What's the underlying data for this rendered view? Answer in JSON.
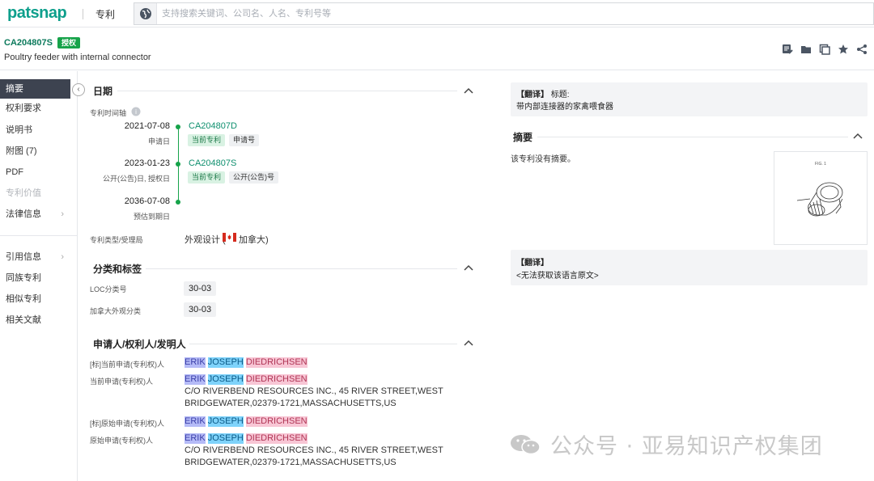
{
  "topbar": {
    "logo": "patsnap",
    "nav_label": "专利",
    "search_placeholder": "支持搜索关键词、公司名、人名、专利号等"
  },
  "header": {
    "patent_id": "CA204807S",
    "status_badge": "授权",
    "title": "Poultry feeder with internal connector"
  },
  "sidebar": {
    "items": [
      {
        "label": "摘要",
        "active": true
      },
      {
        "label": "权利要求"
      },
      {
        "label": "说明书"
      },
      {
        "label": "附图 (7)"
      },
      {
        "label": "PDF"
      },
      {
        "label": "专利价值",
        "disabled": true
      },
      {
        "label": "法律信息",
        "chevron": true
      },
      {
        "label": "引用信息",
        "chevron": true
      },
      {
        "label": "同族专利"
      },
      {
        "label": "相似专利"
      },
      {
        "label": "相关文献"
      }
    ]
  },
  "dates": {
    "section_title": "日期",
    "timeline_label": "专利时间轴",
    "events": [
      {
        "date": "2021-07-08",
        "sub": "申请日",
        "link": "CA204807D",
        "chips": [
          "当前专利",
          "申请号"
        ]
      },
      {
        "date": "2023-01-23",
        "sub": "公开(公告)日, 授权日",
        "link": "CA204807S",
        "chips": [
          "当前专利",
          "公开(公告)号"
        ]
      },
      {
        "date": "2036-07-08",
        "sub": "预估到期日"
      }
    ],
    "type_label": "专利类型/受理局",
    "type_value_prefix": "外观设计 (",
    "type_value_country": "加拿大)"
  },
  "classification": {
    "section_title": "分类和标签",
    "loc_label": "LOC分类号",
    "loc_value": "30-03",
    "ca_label": "加拿大外观分类",
    "ca_value": "30-03"
  },
  "applicants": {
    "section_title": "申请人/权利人/发明人",
    "rows": [
      {
        "label": "[标]当前申请(专利权)人",
        "name": [
          "ERIK",
          "JOSEPH",
          "DIEDRICHSEN"
        ]
      },
      {
        "label": "当前申请(专利权)人",
        "name": [
          "ERIK",
          "JOSEPH",
          "DIEDRICHSEN"
        ],
        "address1": "C/O RIVERBEND RESOURCES INC., 45 RIVER STREET,WEST",
        "address2": "BRIDGEWATER,02379-1721,MASSACHUSETTS,US"
      },
      {
        "label": "[标]原始申请(专利权)人",
        "name": [
          "ERIK",
          "JOSEPH",
          "DIEDRICHSEN"
        ]
      },
      {
        "label": "原始申请(专利权)人",
        "name": [
          "ERIK",
          "JOSEPH",
          "DIEDRICHSEN"
        ],
        "address1": "C/O RIVERBEND RESOURCES INC., 45 RIVER STREET,WEST",
        "address2": "BRIDGEWATER,02379-1721,MASSACHUSETTS,US"
      }
    ]
  },
  "right": {
    "title_translation_tag": "【翻译】",
    "title_label": "标题:",
    "title_translated": "带内部连接器的家禽喂食器",
    "abstract_title": "摘要",
    "abstract_text": "该专利没有摘要。",
    "figure_caption": "FIG. 1",
    "abstract_translation_tag": "【翻译】",
    "abstract_translation_text": "<无法获取该语言原文>"
  },
  "watermark": "公众号 · 亚易知识产权集团"
}
